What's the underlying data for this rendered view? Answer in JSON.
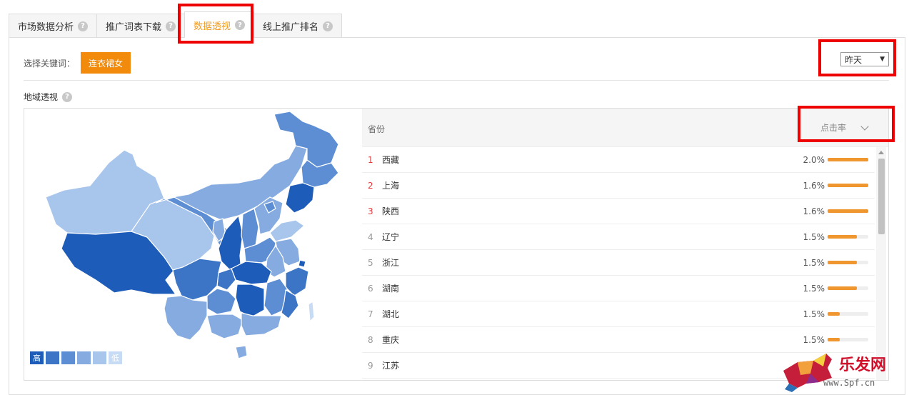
{
  "tabs": [
    {
      "label": "市场数据分析",
      "active": false
    },
    {
      "label": "推广词表下载",
      "active": false
    },
    {
      "label": "数据透视",
      "active": true
    },
    {
      "label": "线上推广排名",
      "active": false
    }
  ],
  "keyword": {
    "label": "选择关键词：",
    "value": "连衣裙女"
  },
  "date_select": {
    "value": "昨天"
  },
  "section": {
    "title": "地域透视"
  },
  "legend": {
    "high": "高",
    "low": "低",
    "colors": [
      "#1d5cb8",
      "#3c75c6",
      "#5d8ed3",
      "#85abe0",
      "#a8c5ec",
      "#c7dbf5"
    ]
  },
  "table": {
    "col_province": "省份",
    "metric": "点击率",
    "rows": [
      {
        "rank": "1",
        "province": "西藏",
        "value": "2.0%",
        "fill": 1.0
      },
      {
        "rank": "2",
        "province": "上海",
        "value": "1.6%",
        "fill": 1.0
      },
      {
        "rank": "3",
        "province": "陕西",
        "value": "1.6%",
        "fill": 1.0
      },
      {
        "rank": "4",
        "province": "辽宁",
        "value": "1.5%",
        "fill": 0.72
      },
      {
        "rank": "5",
        "province": "浙江",
        "value": "1.5%",
        "fill": 0.72
      },
      {
        "rank": "6",
        "province": "湖南",
        "value": "1.5%",
        "fill": 0.72
      },
      {
        "rank": "7",
        "province": "湖北",
        "value": "1.5%",
        "fill": 0.3
      },
      {
        "rank": "8",
        "province": "重庆",
        "value": "1.5%",
        "fill": 0.3
      },
      {
        "rank": "9",
        "province": "江苏",
        "value": "",
        "fill": 0
      }
    ]
  },
  "watermark": {
    "brand": "乐发网",
    "url": "www.Spf.cn"
  }
}
